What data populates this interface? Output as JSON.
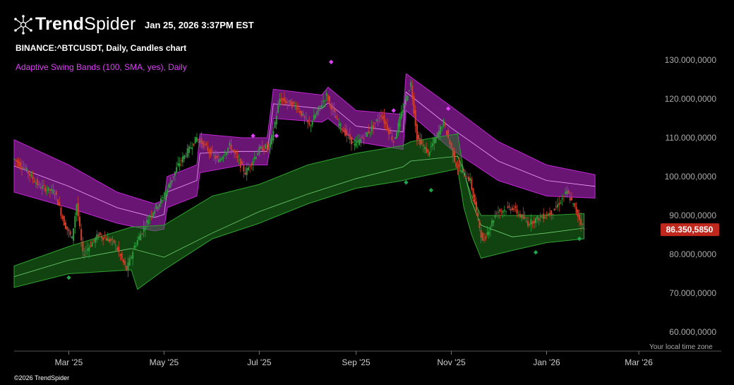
{
  "header": {
    "brand_bold": "Trend",
    "brand_light": "Spider",
    "timestamp": "Jan 25, 2026 3:37PM EST",
    "symbol_line": "BINANCE:^BTCUSDT, Daily, Candles chart",
    "indicator_line": "Adaptive Swing Bands (100, SMA, yes), Daily"
  },
  "footer": {
    "copyright": "©2026 TrendSpider",
    "timezone": "Your local time zone"
  },
  "colors": {
    "background": "#000000",
    "up": "#2e9a3e",
    "down": "#d2402c",
    "upper_band": "#c026d3",
    "lower_band": "#1f7a1f",
    "price_badge": "#c0281e",
    "signal_upper": "#e040fb",
    "signal_lower": "#1fa34a"
  },
  "chart_data": {
    "type": "candlestick",
    "ylim": [
      55,
      135
    ],
    "yticks": [
      60,
      70,
      80,
      90,
      100,
      110,
      120,
      130
    ],
    "ytick_labels": [
      "60.000,0000",
      "70.000,0000",
      "80.000,0000",
      "90.000,0000",
      "100.000,0000",
      "110.000,0000",
      "120.000,0000",
      "130.000,0000"
    ],
    "x_range": [
      "2025-01-25",
      "2026-03-10"
    ],
    "xticks": [
      {
        "date": "2025-03-01",
        "label": "Mar '25"
      },
      {
        "date": "2025-05-01",
        "label": "May '25"
      },
      {
        "date": "2025-07-01",
        "label": "Jul '25"
      },
      {
        "date": "2025-09-01",
        "label": "Sep '25"
      },
      {
        "date": "2025-11-01",
        "label": "Nov '25"
      },
      {
        "date": "2026-01-01",
        "label": "Jan '26"
      },
      {
        "date": "2026-03-01",
        "label": "Mar '26"
      }
    ],
    "last_price": 86.35,
    "last_price_label": "86.350,5850",
    "price_path": [
      [
        "2025-01-25",
        104.5
      ],
      [
        "2025-02-01",
        102
      ],
      [
        "2025-02-10",
        97.5
      ],
      [
        "2025-02-20",
        96
      ],
      [
        "2025-02-26",
        88
      ],
      [
        "2025-03-03",
        84
      ],
      [
        "2025-03-06",
        93
      ],
      [
        "2025-03-10",
        80
      ],
      [
        "2025-03-20",
        85
      ],
      [
        "2025-03-30",
        83
      ],
      [
        "2025-04-07",
        76
      ],
      [
        "2025-04-12",
        82
      ],
      [
        "2025-04-22",
        90
      ],
      [
        "2025-05-01",
        95
      ],
      [
        "2025-05-10",
        103
      ],
      [
        "2025-05-22",
        110
      ],
      [
        "2025-06-05",
        104
      ],
      [
        "2025-06-12",
        108
      ],
      [
        "2025-06-22",
        101
      ],
      [
        "2025-07-01",
        107
      ],
      [
        "2025-07-08",
        108
      ],
      [
        "2025-07-14",
        120
      ],
      [
        "2025-07-25",
        118
      ],
      [
        "2025-08-02",
        113
      ],
      [
        "2025-08-13",
        121
      ],
      [
        "2025-08-20",
        114
      ],
      [
        "2025-08-31",
        108
      ],
      [
        "2025-09-10",
        112
      ],
      [
        "2025-09-17",
        116
      ],
      [
        "2025-09-25",
        109
      ],
      [
        "2025-10-02",
        119
      ],
      [
        "2025-10-06",
        124
      ],
      [
        "2025-10-10",
        110
      ],
      [
        "2025-10-17",
        106
      ],
      [
        "2025-10-27",
        114
      ],
      [
        "2025-11-04",
        103
      ],
      [
        "2025-11-13",
        99
      ],
      [
        "2025-11-21",
        83
      ],
      [
        "2025-11-30",
        91
      ],
      [
        "2025-12-10",
        92
      ],
      [
        "2025-12-20",
        88
      ],
      [
        "2026-01-05",
        91
      ],
      [
        "2026-01-14",
        96
      ],
      [
        "2026-01-20",
        91
      ],
      [
        "2026-01-25",
        86.35
      ]
    ],
    "upper_band": {
      "top": [
        [
          "2025-01-25",
          109.5
        ],
        [
          "2025-03-01",
          103
        ],
        [
          "2025-04-01",
          96
        ],
        [
          "2025-04-25",
          93
        ],
        [
          "2025-05-01",
          94
        ],
        [
          "2025-05-03",
          100
        ],
        [
          "2025-05-22",
          103
        ],
        [
          "2025-05-24",
          111
        ],
        [
          "2025-06-20",
          110
        ],
        [
          "2025-07-06",
          110
        ],
        [
          "2025-07-08",
          116
        ],
        [
          "2025-07-10",
          122.5
        ],
        [
          "2025-08-10",
          121
        ],
        [
          "2025-08-14",
          123
        ],
        [
          "2025-09-01",
          117
        ],
        [
          "2025-10-01",
          116
        ],
        [
          "2025-10-03",
          126.5
        ],
        [
          "2025-11-01",
          118
        ],
        [
          "2025-12-01",
          109
        ],
        [
          "2026-01-01",
          103
        ],
        [
          "2026-02-01",
          100.5
        ]
      ],
      "bottom": [
        [
          "2025-01-25",
          96
        ],
        [
          "2025-03-01",
          92
        ],
        [
          "2025-04-01",
          88
        ],
        [
          "2025-04-25",
          86
        ],
        [
          "2025-05-01",
          86.5
        ],
        [
          "2025-05-03",
          92
        ],
        [
          "2025-05-22",
          95
        ],
        [
          "2025-05-24",
          101
        ],
        [
          "2025-06-20",
          103
        ],
        [
          "2025-07-06",
          103
        ],
        [
          "2025-07-08",
          108
        ],
        [
          "2025-07-10",
          115
        ],
        [
          "2025-08-10",
          114
        ],
        [
          "2025-08-14",
          115
        ],
        [
          "2025-09-01",
          109
        ],
        [
          "2025-10-01",
          107
        ],
        [
          "2025-10-03",
          117
        ],
        [
          "2025-11-01",
          107
        ],
        [
          "2025-12-01",
          99
        ],
        [
          "2026-01-01",
          95
        ],
        [
          "2026-02-01",
          94.5
        ]
      ]
    },
    "lower_band": {
      "top": [
        [
          "2025-01-25",
          77
        ],
        [
          "2025-03-01",
          82
        ],
        [
          "2025-04-10",
          87
        ],
        [
          "2025-05-01",
          87.5
        ],
        [
          "2025-06-01",
          95
        ],
        [
          "2025-07-01",
          98
        ],
        [
          "2025-08-01",
          103
        ],
        [
          "2025-09-01",
          106
        ],
        [
          "2025-10-01",
          108
        ],
        [
          "2025-10-06",
          109
        ],
        [
          "2025-11-05",
          111
        ],
        [
          "2025-11-09",
          101
        ],
        [
          "2025-11-14",
          95
        ],
        [
          "2025-11-20",
          90
        ],
        [
          "2025-12-10",
          90
        ],
        [
          "2026-01-01",
          90
        ],
        [
          "2026-01-25",
          90.5
        ]
      ],
      "bottom": [
        [
          "2025-01-25",
          71.5
        ],
        [
          "2025-03-01",
          75
        ],
        [
          "2025-04-10",
          76
        ],
        [
          "2025-04-14",
          71
        ],
        [
          "2025-05-01",
          76
        ],
        [
          "2025-06-01",
          84
        ],
        [
          "2025-07-01",
          88
        ],
        [
          "2025-08-01",
          93
        ],
        [
          "2025-09-01",
          97
        ],
        [
          "2025-10-01",
          99
        ],
        [
          "2025-10-06",
          99.5
        ],
        [
          "2025-11-05",
          102
        ],
        [
          "2025-11-09",
          92
        ],
        [
          "2025-11-14",
          85
        ],
        [
          "2025-11-20",
          79
        ],
        [
          "2025-12-10",
          81
        ],
        [
          "2026-01-01",
          83
        ],
        [
          "2026-01-25",
          84
        ]
      ]
    },
    "upper_signals": [
      [
        "2025-06-27",
        110.5
      ],
      [
        "2025-07-12",
        110.5
      ],
      [
        "2025-08-16",
        129.5
      ],
      [
        "2025-09-25",
        117
      ],
      [
        "2025-10-30",
        117.5
      ]
    ],
    "lower_signals": [
      [
        "2025-03-01",
        74
      ],
      [
        "2025-10-03",
        98.5
      ],
      [
        "2025-10-19",
        96.5
      ],
      [
        "2025-12-25",
        80.5
      ],
      [
        "2026-01-22",
        84
      ]
    ]
  }
}
